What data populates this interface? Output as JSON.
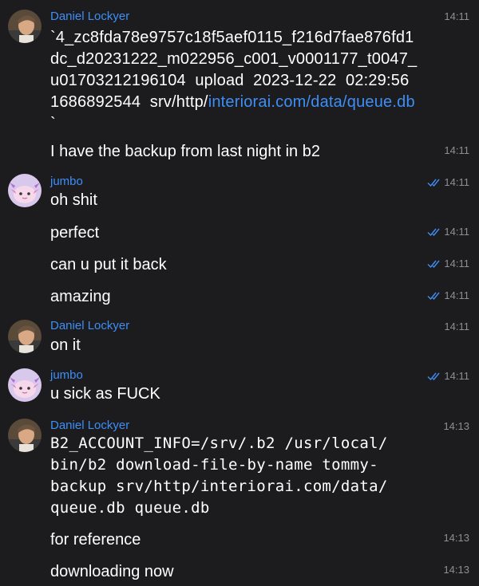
{
  "users": {
    "daniel": {
      "name": "Daniel Lockyer",
      "avatar_icon": "user-photo-avatar"
    },
    "jumbo": {
      "name": "jumbo",
      "avatar_icon": "axolotl-avatar"
    }
  },
  "colors": {
    "background": "#1c1c1e",
    "author": "#3e8ef7",
    "link": "#3e8ef7",
    "time": "#8e8e93",
    "read_check": "#3e8ef7"
  },
  "messages": [
    {
      "author": "Daniel Lockyer",
      "time": "14:11",
      "lines": [
        "`4_zc8fda78e9757c18f5aef0115_f216d7fae876fd1",
        "dc_d20231222_m022956_c001_v0001177_t0047_",
        "u01703212196104  upload  2023-12-22  02:29:56"
      ],
      "last_line_prefix": "1686892544  srv/http/",
      "link_text": "interiorai.com/data/queue.db",
      "closing": "`"
    },
    {
      "text": "I have the backup from last night in b2",
      "time": "14:11"
    },
    {
      "author": "jumbo",
      "text": "oh shit",
      "time": "14:11",
      "read": true
    },
    {
      "text": "perfect",
      "time": "14:11",
      "read": true
    },
    {
      "text": "can u put it back",
      "time": "14:11",
      "read": true
    },
    {
      "text": "amazing",
      "time": "14:11",
      "read": true
    },
    {
      "author": "Daniel Lockyer",
      "text": "on it",
      "time": "14:11"
    },
    {
      "author": "jumbo",
      "text": "u sick as FUCK",
      "time": "14:11",
      "read": true
    },
    {
      "author": "Daniel Lockyer",
      "time": "14:13",
      "code_lines": [
        "B2_ACCOUNT_INFO=/srv/.b2 /usr/local/",
        "bin/b2 download-file-by-name tommy-",
        "backup srv/http/interiorai.com/data/",
        "queue.db queue.db"
      ]
    },
    {
      "text": "for reference",
      "time": "14:13"
    },
    {
      "text": "downloading now",
      "time": "14:13"
    }
  ]
}
